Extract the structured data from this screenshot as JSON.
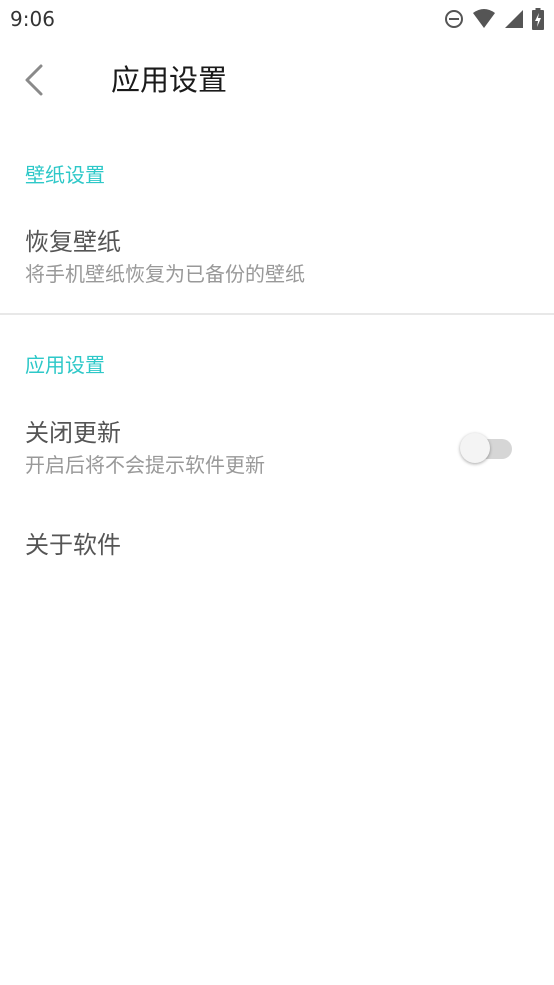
{
  "status_bar": {
    "time": "9:06",
    "icons": [
      "do-not-disturb-icon",
      "wifi-icon",
      "signal-icon",
      "battery-charging-icon"
    ]
  },
  "app_bar": {
    "back_icon": "chevron-left-icon",
    "title": "应用设置"
  },
  "sections": [
    {
      "header": "壁纸设置",
      "items": [
        {
          "title": "恢复壁纸",
          "summary": "将手机壁纸恢复为已备份的壁纸"
        }
      ]
    },
    {
      "header": "应用设置",
      "items": [
        {
          "title": "关闭更新",
          "summary": "开启后将不会提示软件更新",
          "toggle": {
            "checked": false
          }
        },
        {
          "title": "关于软件"
        }
      ]
    }
  ],
  "colors": {
    "accent": "#2ec8c8",
    "title_text": "#555555",
    "summary_text": "#999999",
    "background": "#ffffff"
  }
}
